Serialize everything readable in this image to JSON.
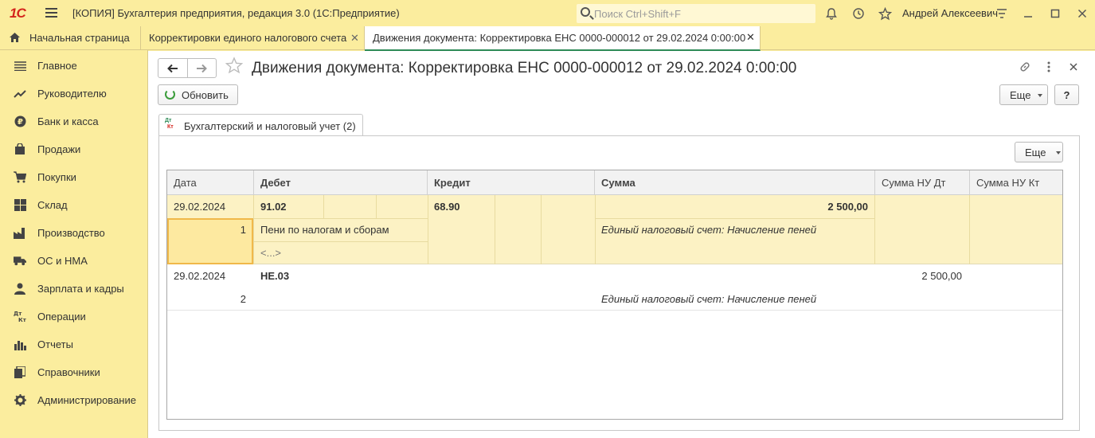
{
  "titlebar": {
    "logo": "1С",
    "app_title": "[КОПИЯ] Бухгалтерия предприятия, редакция 3.0  (1С:Предприятие)",
    "search_placeholder": "Поиск Ctrl+Shift+F",
    "user_name": "Андрей Алексеевич"
  },
  "tabs": [
    {
      "label": "Начальная страница"
    },
    {
      "label": "Корректировки единого налогового счета"
    },
    {
      "label": "Движения документа: Корректировка ЕНС 0000-000012 от 29.02.2024 0:00:00"
    }
  ],
  "sidebar": {
    "items": [
      {
        "label": "Главное",
        "icon": "menu-icon"
      },
      {
        "label": "Руководителю",
        "icon": "trend-icon"
      },
      {
        "label": "Банк и касса",
        "icon": "ruble-icon"
      },
      {
        "label": "Продажи",
        "icon": "bag-icon"
      },
      {
        "label": "Покупки",
        "icon": "cart-icon"
      },
      {
        "label": "Склад",
        "icon": "grid-icon"
      },
      {
        "label": "Производство",
        "icon": "factory-icon"
      },
      {
        "label": "ОС и НМА",
        "icon": "truck-icon"
      },
      {
        "label": "Зарплата и кадры",
        "icon": "person-icon"
      },
      {
        "label": "Операции",
        "icon": "dt-kt-icon"
      },
      {
        "label": "Отчеты",
        "icon": "bar-chart-icon"
      },
      {
        "label": "Справочники",
        "icon": "books-icon"
      },
      {
        "label": "Администрирование",
        "icon": "gear-icon"
      }
    ]
  },
  "document": {
    "title": "Движения документа: Корректировка ЕНС 0000-000012 от 29.02.2024 0:00:00",
    "refresh_label": "Обновить",
    "more_label": "Еще",
    "help_label": "?",
    "form_tab": "Бухгалтерский и налоговый учет (2)",
    "dt_kt": {
      "dt": "Дт",
      "kt": "Кт"
    },
    "inner_more_label": "Еще"
  },
  "table": {
    "columns": [
      "Дата",
      "Дебет",
      "Кредит",
      "Сумма",
      "Сумма НУ Дт",
      "Сумма НУ Кт"
    ],
    "rows": [
      {
        "date": "29.02.2024",
        "number": "1",
        "debit": "91.02",
        "debit_subconto": "Пени по налогам и сборам",
        "debit_subconto2": "<...>",
        "credit": "68.90",
        "sum": "2 500,00",
        "content": "Единый налоговый счет: Начисление пеней",
        "sum_nu_dt": "",
        "sum_nu_kt": ""
      },
      {
        "date": "29.02.2024",
        "number": "2",
        "debit": "НЕ.03",
        "credit": "",
        "sum": "",
        "content": "Единый налоговый счет: Начисление пеней",
        "sum_nu_dt": "2 500,00",
        "sum_nu_kt": ""
      }
    ]
  },
  "colors": {
    "panel_bg": "#fbed9e",
    "selected_row": "#fcf2c4",
    "accent_green": "#2e8b57",
    "logo_red": "#d4241c"
  }
}
